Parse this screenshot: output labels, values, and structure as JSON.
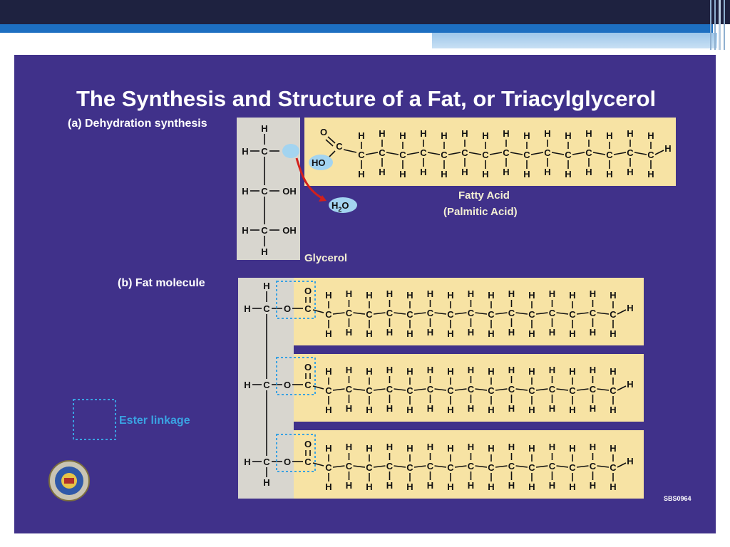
{
  "slide": {
    "title": "The Synthesis and Structure of a Fat, or Triacylglycerol",
    "label_a": "(a) Dehydration synthesis",
    "label_b": "(b) Fat molecule",
    "fatty_acid_name": "Fatty Acid",
    "fatty_acid_subname": "(Palmitic Acid)",
    "glycerol_label": "Glycerol",
    "ester_label": "Ester linkage",
    "water_main": "H",
    "water_sub": "2",
    "water_tail": "O",
    "ho_label": "HO",
    "code": "SBS0964"
  },
  "atoms": {
    "h": "H",
    "c": "C",
    "o": "O",
    "oh": "OH"
  },
  "colors": {
    "panel": "#40318a",
    "fatty_acid_bg": "#f7e3a4",
    "glycerol_bg": "#d8d6cf",
    "water_bubble": "#a3d4f0",
    "arrow": "#d2201c",
    "ester_box": "#3aa2e2"
  },
  "icons": [
    "institution-seal-icon"
  ]
}
